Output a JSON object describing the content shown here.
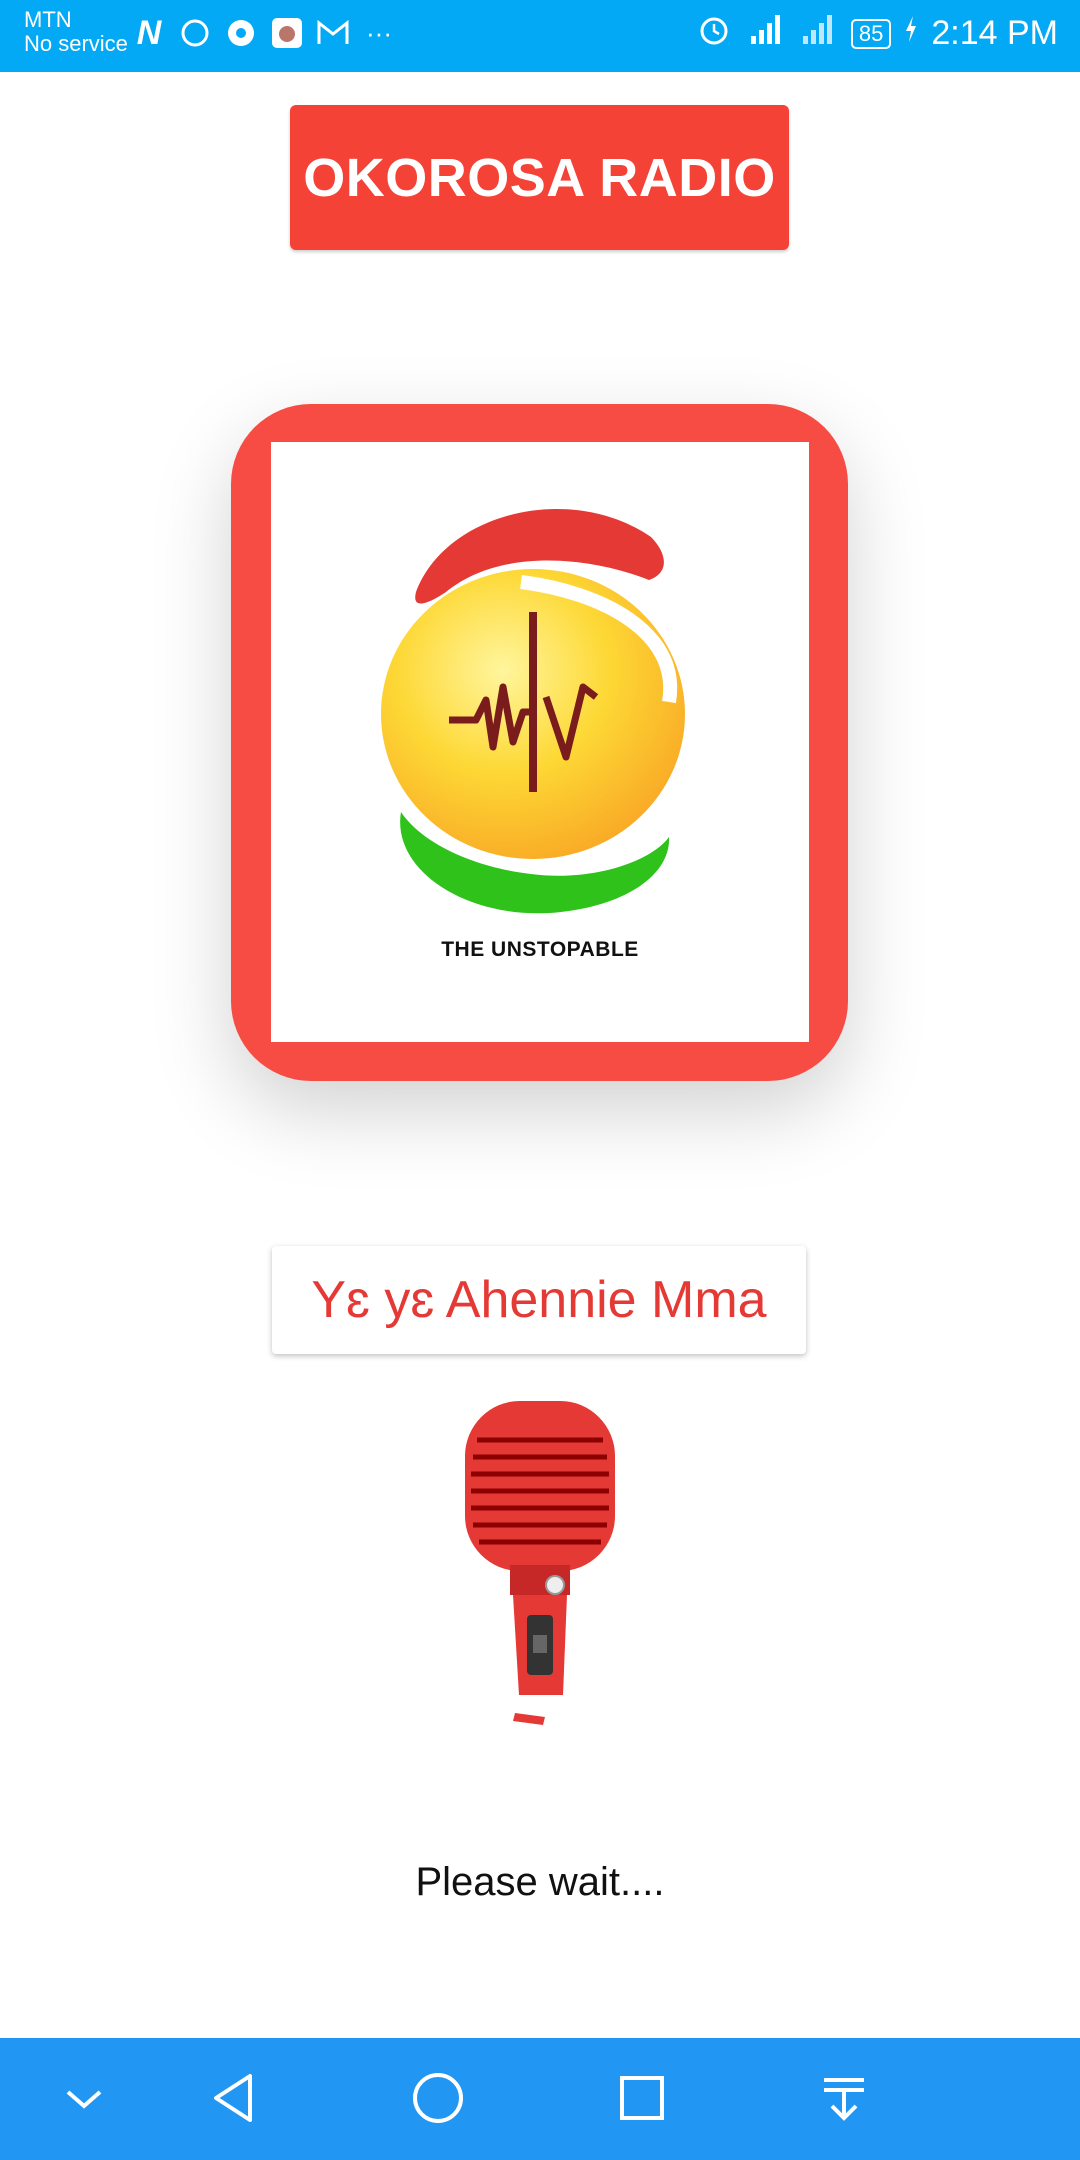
{
  "status_bar": {
    "carrier": "MTN",
    "service": "No service",
    "battery": "85",
    "time": "2:14 PM",
    "notification_icons": [
      "n-app-icon",
      "circle-icon",
      "chrome-icon",
      "app-icon",
      "gmail-icon",
      "more-icon"
    ],
    "status_icons": [
      "alarm-icon",
      "signal-icon",
      "signal-icon",
      "battery-icon",
      "charging-icon"
    ],
    "color": "#03a9f4"
  },
  "header": {
    "title": "OKOROSA RADIO",
    "color": "#f44336"
  },
  "logo": {
    "caption": "THE UNSTOPABLE"
  },
  "slogan": {
    "text": "Yɛ yɛ Ahennie Mma",
    "color": "#e53935"
  },
  "status": {
    "message": "Please wait...."
  },
  "nav_bar": {
    "buttons": [
      "collapse-icon",
      "back-icon",
      "home-icon",
      "recents-icon",
      "notifications-pull-icon"
    ],
    "color": "#2196f3"
  }
}
